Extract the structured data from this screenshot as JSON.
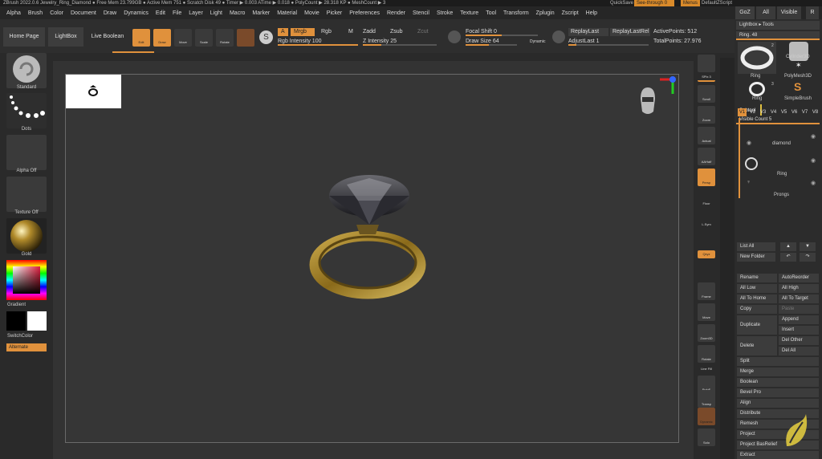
{
  "title_bar": {
    "text": "ZBrush 2022.0.6   Jewelry_Ring_Diamond   ● Free Mem 23.799GB ● Active Mem 751 ● Scratch Disk 49 ● Timer ▶ 0.003 ATime ▶ 0.018 ● PolyCount ▶ 28.318 KP ● MeshCount ▶ 3",
    "quicksave": "QuickSave",
    "seethrough": "See-through 0",
    "menus": "Menus",
    "default_zscript": "DefaultZScript"
  },
  "menus": [
    "Alpha",
    "Brush",
    "Color",
    "Document",
    "Draw",
    "Dynamics",
    "Edit",
    "File",
    "Layer",
    "Light",
    "Macro",
    "Marker",
    "Material",
    "Movie",
    "Picker",
    "Preferences",
    "Render",
    "Stencil",
    "Stroke",
    "Texture",
    "Tool",
    "Transform",
    "Zplugin",
    "Zscript",
    "Help"
  ],
  "tray_tabs": {
    "goz": "GoZ",
    "all": "All",
    "visible": "Visible",
    "r": "R"
  },
  "toolbar": {
    "home": "Home Page",
    "lightbox": "LightBox",
    "live_boolean": "Live Boolean",
    "edit": "Edit",
    "draw": "Draw",
    "move": "Move",
    "scale": "Scale",
    "rotate": "Rotate",
    "a": "A",
    "mrgb": "Mrgb",
    "rgb": "Rgb",
    "m": "M",
    "zadd": "Zadd",
    "zsub": "Zsub",
    "zcut": "Zcut",
    "rgb_intensity": "Rgb Intensity 100",
    "z_intensity": "Z Intensity 25",
    "focal_shift": "Focal Shift 0",
    "draw_size": "Draw Size 64",
    "dynamic": "Dynamic",
    "replay_last": "ReplayLast",
    "replay_last_rel": "ReplayLastRel",
    "adjust_last": "AdjustLast 1",
    "active_points": "ActivePoints: 512",
    "total_points": "TotalPoints: 27.976"
  },
  "left_shelf": {
    "standard": "Standard",
    "dots": "Dots",
    "alpha_off": "Alpha Off",
    "texture_off": "Texture Off",
    "gold": "Gold",
    "gradient": "Gradient",
    "switch_color": "SwitchColor",
    "alternate": "Alternate"
  },
  "right_shelf": {
    "spix": "SPix 3",
    "scroll": "Scroll",
    "zoom": "Zoom",
    "actual": "Actual",
    "aahalf": "AAHalf",
    "persp": "Persp",
    "floor": "Floor",
    "lsym": "L.Sym",
    "qxyz": "Qxyz",
    "frame": "Frame",
    "move": "Move",
    "zoom3d": "Zoom3D",
    "rotate": "Rotate",
    "line_fill": "Line Fill",
    "polyf": "PolyF",
    "transp": "Transp",
    "ghost": "Ghost",
    "dynamic": "Dynamic",
    "solo": "Solo"
  },
  "tool_panel": {
    "lightbox_tools": "Lightbox ▸ Tools",
    "ring_slider": "Ring. 48",
    "ring": "Ring",
    "cylinder3d": "Cylinder3D",
    "polymesh3d": "PolyMesh3D",
    "ring2": "Ring",
    "simplebrush": "SimpleBrush",
    "count1": "2",
    "count2": "3"
  },
  "subtool": {
    "header": "Subtool",
    "visible_count": "Visible Count 5",
    "tabs": [
      "V1",
      "V2",
      "V3",
      "V4",
      "V5",
      "V6",
      "V7",
      "V8"
    ],
    "items": [
      "diamond",
      "Ring",
      "Prongs"
    ]
  },
  "actions": {
    "list_all": "List All",
    "new_folder": "New Folder",
    "rename": "Rename",
    "auto_reorder": "AutoReorder",
    "all_low": "All Low",
    "all_high": "All High",
    "all_to_home": "All To Home",
    "all_to_target": "All To Target",
    "copy": "Copy",
    "paste": "Paste",
    "duplicate": "Duplicate",
    "append": "Append",
    "insert": "Insert",
    "delete": "Delete",
    "del_other": "Del Other",
    "del_all": "Del All",
    "split": "Split",
    "merge": "Merge",
    "boolean": "Boolean",
    "bevel_pro": "Bevel Pro",
    "align": "Align",
    "distribute": "Distribute",
    "remesh": "Remesh",
    "project": "Project",
    "project_basrelief": "Project BasRelief",
    "extract": "Extract"
  },
  "accent": "#e0913c"
}
